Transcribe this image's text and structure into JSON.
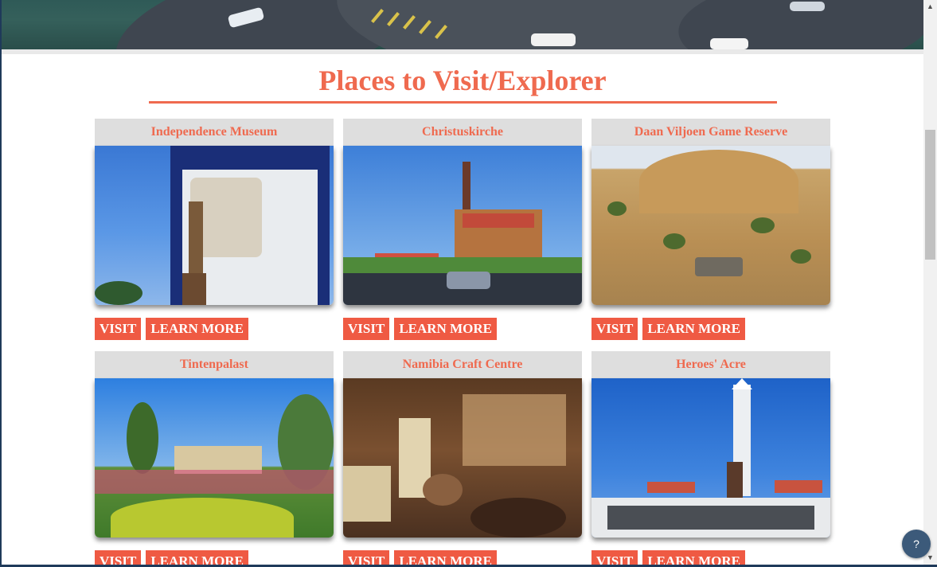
{
  "section_title": "Places to Visit/Explorer",
  "places": [
    {
      "name": "Independence Museum",
      "visit_label": "VISIT",
      "learn_label": "LEARN MORE"
    },
    {
      "name": "Christuskirche",
      "visit_label": "VISIT",
      "learn_label": "LEARN MORE"
    },
    {
      "name": "Daan Viljoen Game Reserve",
      "visit_label": "VISIT",
      "learn_label": "LEARN MORE"
    },
    {
      "name": "Tintenpalast",
      "visit_label": "VISIT",
      "learn_label": "LEARN MORE"
    },
    {
      "name": "Namibia Craft Centre",
      "visit_label": "VISIT",
      "learn_label": "LEARN MORE"
    },
    {
      "name": "Heroes' Acre",
      "visit_label": "VISIT",
      "learn_label": "LEARN MORE"
    }
  ],
  "help_button": {
    "label": "?"
  },
  "scrollbar": {
    "up_glyph": "▲",
    "down_glyph": "▼"
  },
  "colors": {
    "accent": "#ef6a4f",
    "button": "#ef5a43",
    "card_header": "#dedede",
    "help_button": "#3c5a7a"
  }
}
